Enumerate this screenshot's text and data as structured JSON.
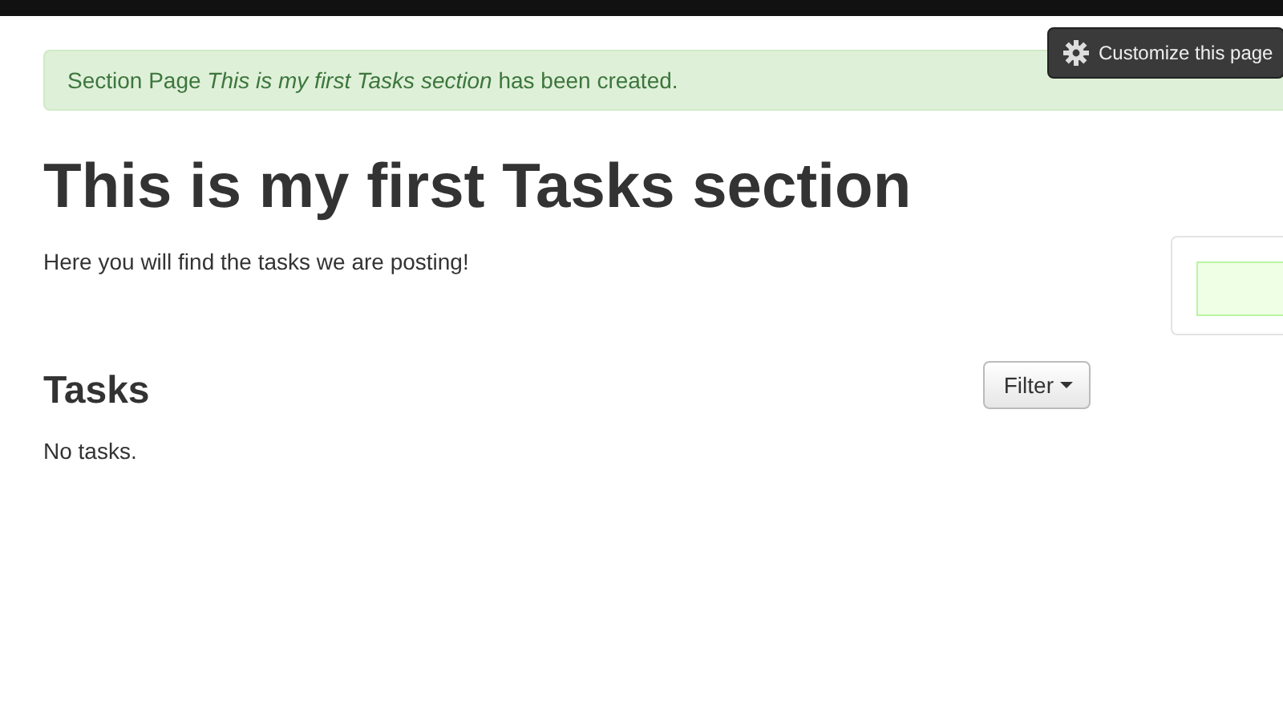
{
  "customize_button": {
    "label": "Customize this page"
  },
  "alert": {
    "text": "Section Page *This is my first Tasks section* has been created."
  },
  "page": {
    "title": "This is my first Tasks section",
    "description": "Here you will find the tasks we are posting!"
  },
  "tasks": {
    "heading": "Tasks",
    "filter_button": "Filter",
    "empty_text": "No tasks."
  }
}
